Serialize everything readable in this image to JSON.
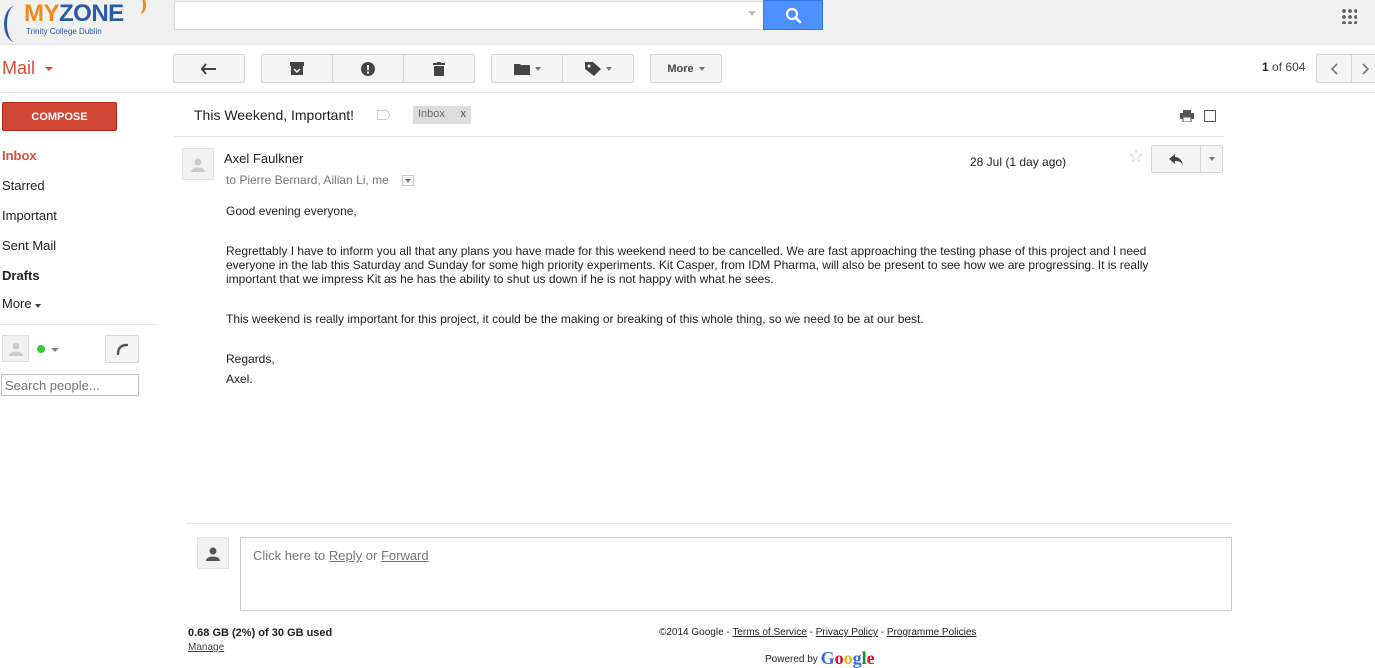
{
  "logo": {
    "brand_prefix": "MY",
    "brand_rest": "ZONE",
    "subtitle": "Trinity College Dublin"
  },
  "search": {
    "placeholder": ""
  },
  "app_label": "Mail",
  "toolbar": {
    "more_label": "More"
  },
  "pager": {
    "current": "1",
    "of_label": "of",
    "total": "604"
  },
  "sidebar": {
    "compose_label": "COMPOSE",
    "items": [
      {
        "label": "Inbox"
      },
      {
        "label": "Starred"
      },
      {
        "label": "Important"
      },
      {
        "label": "Sent Mail"
      },
      {
        "label": "Drafts"
      },
      {
        "label": "More"
      }
    ],
    "people_search_placeholder": "Search people...",
    "status_color": "#33cc33"
  },
  "email": {
    "subject": "This Weekend, Important!",
    "label_chip": "Inbox",
    "label_chip_close": "x",
    "sender": "Axel Faulkner",
    "recipients": "to Pierre Bernard, Ailian Li, me",
    "date": "28 Jul (1 day ago)",
    "body": [
      "Good evening everyone,",
      "Regrettably I have to inform you all that any plans you have made for this weekend need to be cancelled.  We are fast approaching the testing phase of this project and I need",
      "everyone in the lab this Saturday and Sunday for some high priority experiments.  Kit Casper, from IDM Pharma, will also be present to see how we are progressing.  It is really",
      "important that we impress Kit as he has the ability to shut us down if he is not happy with what he sees.",
      "This weekend is really important for this project, it could be the making or breaking of this whole thing, so we need to be at our best.",
      "Regards,",
      "Axel."
    ]
  },
  "reply_box": {
    "prefix": "Click here to",
    "reply": "Reply",
    "or": "or",
    "forward": "Forward"
  },
  "footer": {
    "storage": "0.68 GB (2%) of 30 GB used",
    "manage": "Manage",
    "copyright": "©2014 Google",
    "sep": "-",
    "terms": "Terms of Service",
    "privacy": "Privacy Policy",
    "programme": "Programme Policies",
    "powered_by": "Powered by",
    "google": [
      "G",
      "o",
      "o",
      "g",
      "l",
      "e"
    ]
  },
  "colors": {
    "accent": "#dd4b39",
    "compose": "#d14836",
    "search_button": "#4d90fe"
  }
}
